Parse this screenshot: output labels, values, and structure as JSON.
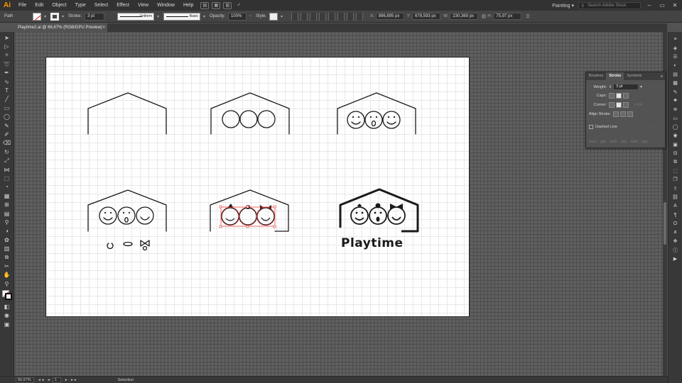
{
  "app": {
    "logo": "Ai"
  },
  "menu": [
    "File",
    "Edit",
    "Object",
    "Type",
    "Select",
    "Effect",
    "View",
    "Window",
    "Help"
  ],
  "menubar_right": {
    "workspace": "Painting",
    "search_placeholder": "Search Adobe Stock"
  },
  "control": {
    "selection_label": "Path",
    "stroke_label": "Stroke:",
    "stroke_weight": "3 pt",
    "profile": "Uniform",
    "brush": "Basic",
    "opacity_label": "Opacity:",
    "opacity": "100%",
    "style_label": "Style:",
    "x_label": "X:",
    "x": "896,895 px",
    "y_label": "Y:",
    "y": "678,593 px",
    "w_label": "W:",
    "w": "230,369 px",
    "h_label": "H:",
    "h": "75,97 px"
  },
  "document": {
    "tab_title": "Playtime2.ai @ 66,67% (RGB/GPU Preview)",
    "close": "×"
  },
  "artwork": {
    "logo_word": "Playtime"
  },
  "stroke_panel": {
    "tabs": [
      "Brushes",
      "Stroke",
      "Symbols"
    ],
    "weight_label": "Weight:",
    "weight": "3 pt",
    "caps_label": "Caps:",
    "corner_label": "Corner:",
    "limit_label": "Limit:",
    "align_label": "Align Stroke:",
    "dashed_label": "Dashed Line",
    "dash_cells": [
      "dash",
      "gap",
      "dash",
      "gap",
      "dash",
      "gap"
    ]
  },
  "status": {
    "zoom": "66,67%",
    "page": "1",
    "tool": "Selection"
  },
  "colors": {
    "accent": "#ff9a00",
    "selection": "#e33b3b",
    "canvas": "#535353",
    "artboard": "#ffffff"
  }
}
